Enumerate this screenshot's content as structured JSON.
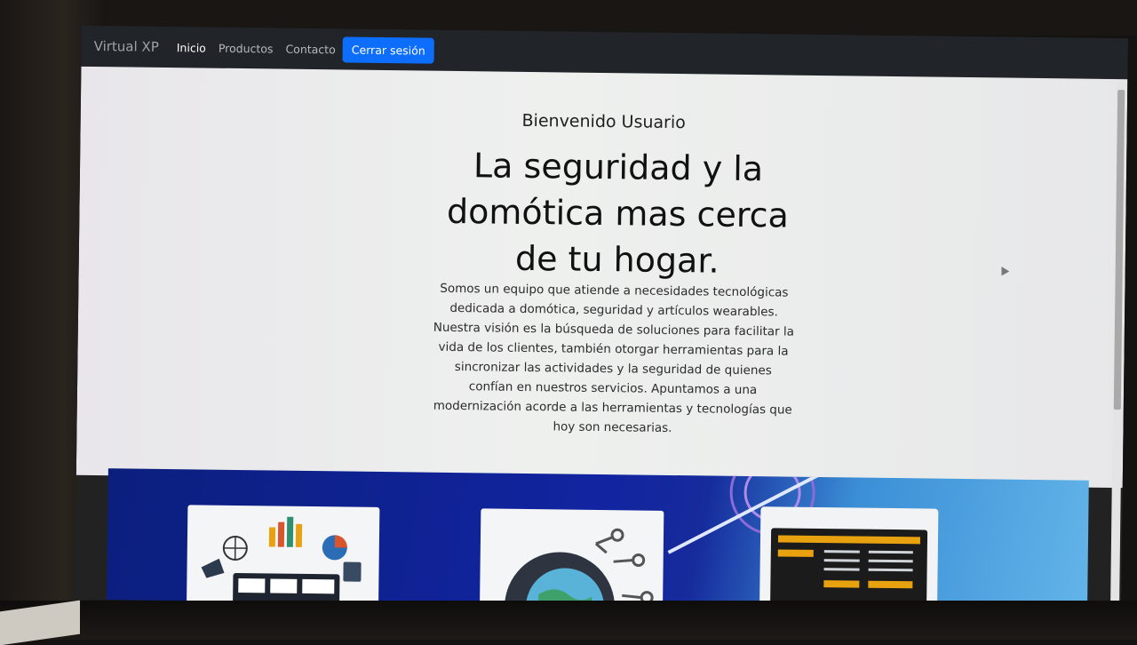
{
  "navbar": {
    "brand": "Virtual XP",
    "links": [
      {
        "label": "Inicio",
        "active": true
      },
      {
        "label": "Productos",
        "active": false
      },
      {
        "label": "Contacto",
        "active": false
      }
    ],
    "logout_label": "Cerrar sesión"
  },
  "hero": {
    "welcome": "Bienvenido Usuario",
    "headline": "La seguridad y la domótica mas cerca de tu hogar.",
    "description": "Somos un equipo que atiende a necesidades tecnológicas dedicada a domótica, seguridad y artículos wearables. Nuestra visión es la búsqueda de soluciones para facilitar la vida de los clientes, también otorgar herramientas para la sincronizar las actividades y la seguridad de quienes confían en nuestros servicios. Apuntamos a una modernización acorde a las herramientas y tecnologías que hoy son necesarias."
  },
  "banner": {
    "cards": [
      {
        "icon": "analytics-illustration-icon"
      },
      {
        "icon": "gear-globe-illustration-icon"
      },
      {
        "icon": "laptop-document-illustration-icon"
      }
    ]
  },
  "colors": {
    "navbar_bg": "#212529",
    "primary_button": "#0d6efd",
    "banner_blue": "#1224a0",
    "accent_yellow": "#e9a20f"
  }
}
